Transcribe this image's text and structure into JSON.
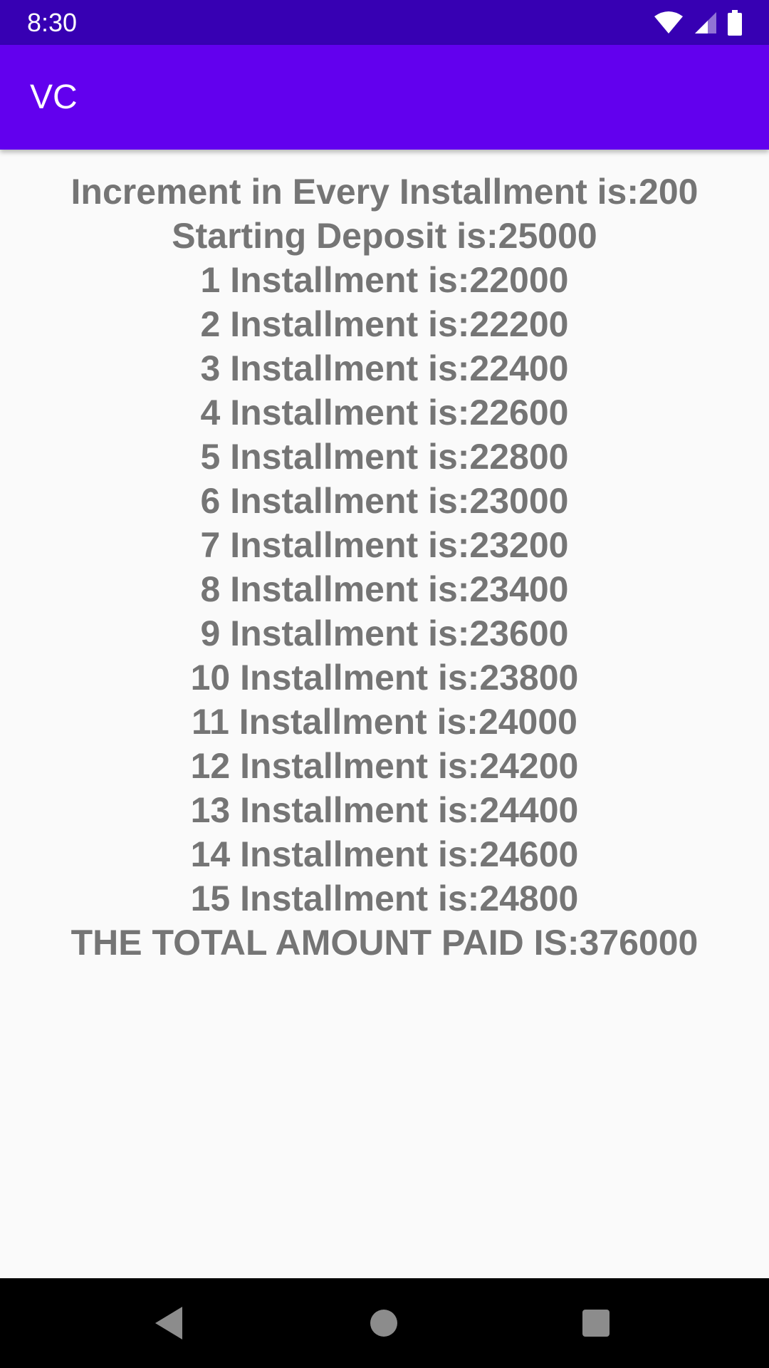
{
  "status_bar": {
    "time": "8:30",
    "icons": [
      "wifi-icon",
      "cell-signal-icon",
      "battery-icon"
    ],
    "color": "#3700b3"
  },
  "app_bar": {
    "title": "VC",
    "color": "#6200ee"
  },
  "content": {
    "increment_line": "Increment in Every Installment is:200",
    "deposit_line": "Starting Deposit is:25000",
    "installments": [
      "1 Installment is:22000",
      "2 Installment is:22200",
      "3 Installment is:22400",
      "4 Installment is:22600",
      "5 Installment is:22800",
      "6 Installment is:23000",
      "7 Installment is:23200",
      "8 Installment is:23400",
      "9 Installment is:23600",
      "10 Installment is:23800",
      "11 Installment is:24000",
      "12 Installment is:24200",
      "13 Installment is:24400",
      "14 Installment is:24600",
      "15 Installment is:24800"
    ],
    "total_line": "THE TOTAL AMOUNT PAID IS:376000",
    "text_color": "#757575"
  },
  "nav_bar": {
    "buttons": [
      "back-icon",
      "home-icon",
      "recents-icon"
    ]
  }
}
